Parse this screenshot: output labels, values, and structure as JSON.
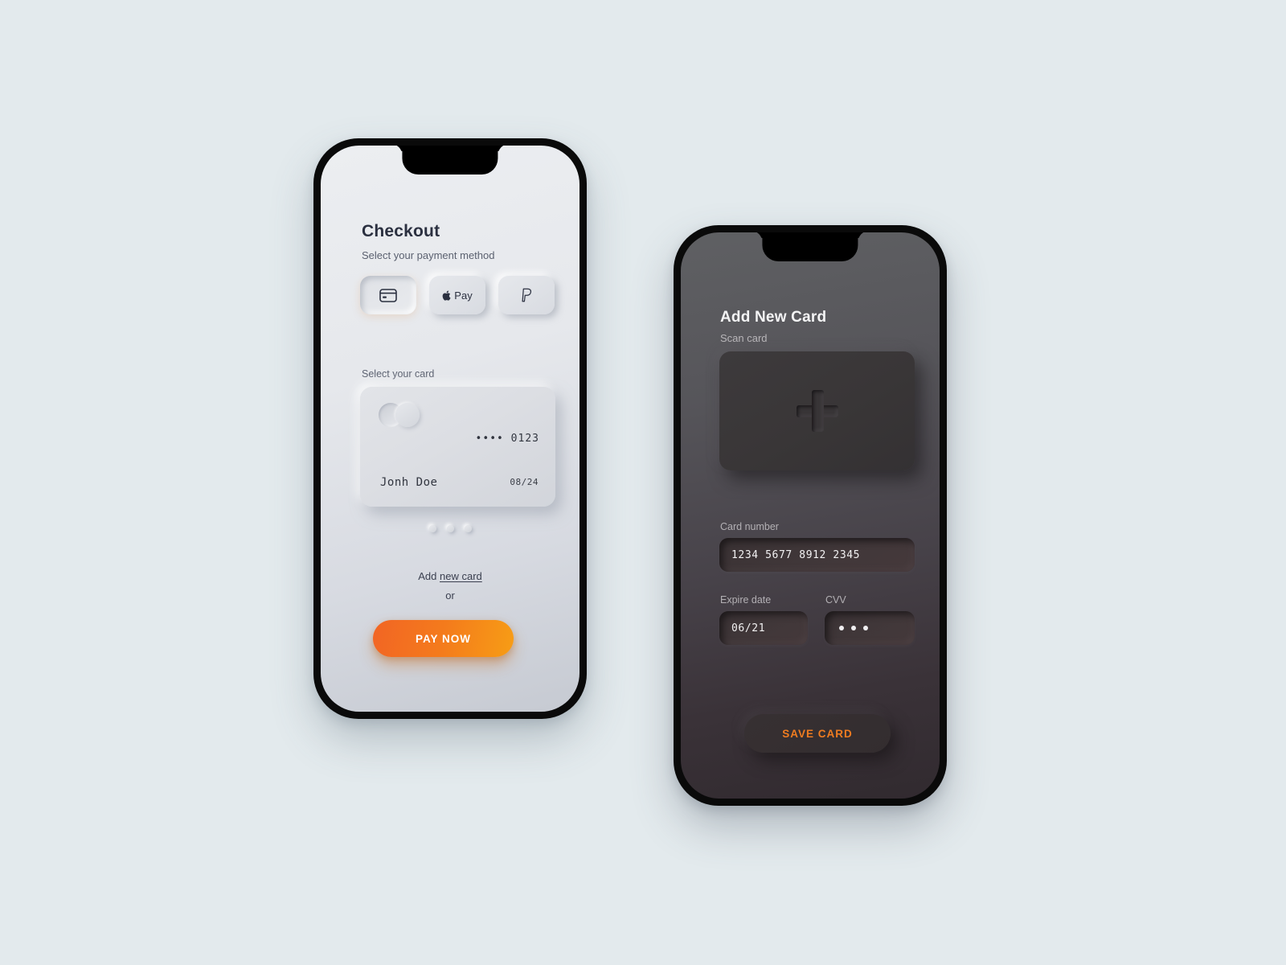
{
  "background_color": "#e3eaed",
  "checkout_screen": {
    "title": "Checkout",
    "subtitle": "Select your payment method",
    "payment_methods": [
      {
        "id": "credit-card",
        "icon": "credit-card-icon",
        "label": "",
        "selected": true
      },
      {
        "id": "apple-pay",
        "icon": "apple-logo-icon",
        "label": "Pay",
        "selected": false
      },
      {
        "id": "paypal",
        "icon": "paypal-icon",
        "label": "",
        "selected": false
      }
    ],
    "select_card_label": "Select your card",
    "card": {
      "logo": "mastercard-circles-icon",
      "masked_number": "•••• 0123",
      "holder_name": "Jonh Doe",
      "expiry": "08/24"
    },
    "carousel_dots": 3,
    "active_dot_index": 0,
    "add_card_prefix": "Add ",
    "add_card_link": "new card",
    "or_text": "or",
    "pay_button": "PAY NOW",
    "pay_button_gradient_from": "#f26524",
    "pay_button_gradient_to": "#f79d15"
  },
  "add_card_screen": {
    "title": "Add New Card",
    "subtitle": "Scan card",
    "scan_card_icon": "plus-icon",
    "fields": [
      {
        "name": "card-number",
        "label": "Card number",
        "value": "1234 5677 8912 2345"
      },
      {
        "name": "expire-date",
        "label": "Expire date",
        "value": "06/21"
      },
      {
        "name": "cvv",
        "label": "CVV",
        "value": "",
        "masked": true,
        "mask_dots": 3
      }
    ],
    "save_button": "SAVE CARD",
    "save_button_color": "#f07c20"
  }
}
